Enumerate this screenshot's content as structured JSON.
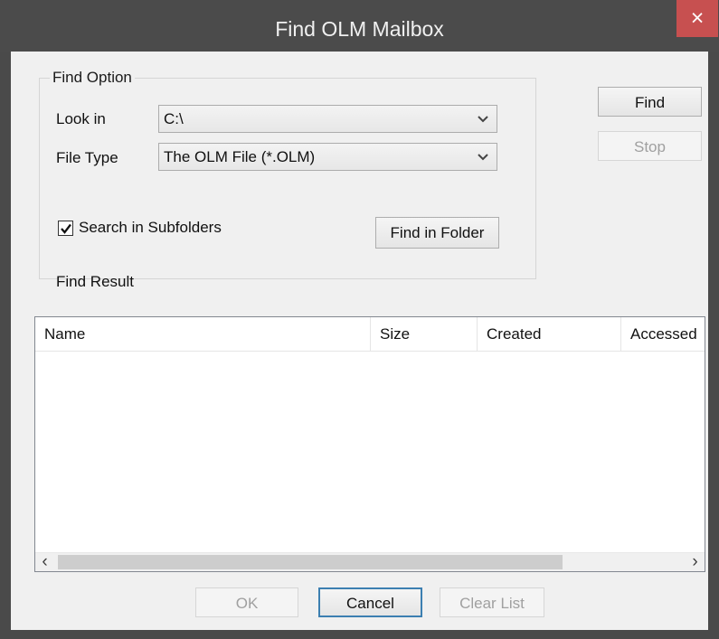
{
  "window": {
    "title": "Find OLM Mailbox",
    "close_symbol": "×"
  },
  "find_option": {
    "title": "Find Option",
    "look_in_label": "Look in",
    "look_in_value": "C:\\",
    "file_type_label": "File Type",
    "file_type_value": "The OLM File (*.OLM)",
    "search_subfolders_label": "Search in Subfolders",
    "search_subfolders_checked": true,
    "find_in_folder_label": "Find in Folder"
  },
  "actions": {
    "find_label": "Find",
    "stop_label": "Stop"
  },
  "results": {
    "title": "Find Result",
    "columns": [
      "Name",
      "Size",
      "Created",
      "Accessed"
    ],
    "rows": [],
    "scroll_left_symbol": "‹",
    "scroll_right_symbol": "›"
  },
  "footer": {
    "ok_label": "OK",
    "cancel_label": "Cancel",
    "clear_list_label": "Clear List"
  },
  "colors": {
    "title_bar": "#4b4b4b",
    "close_button": "#c75050",
    "dialog_background": "#f0f0f0",
    "default_button_border": "#3c7fb1"
  },
  "icons": {
    "dropdown": "chevron-down-icon",
    "checkbox": "check-icon",
    "close": "close-icon"
  }
}
